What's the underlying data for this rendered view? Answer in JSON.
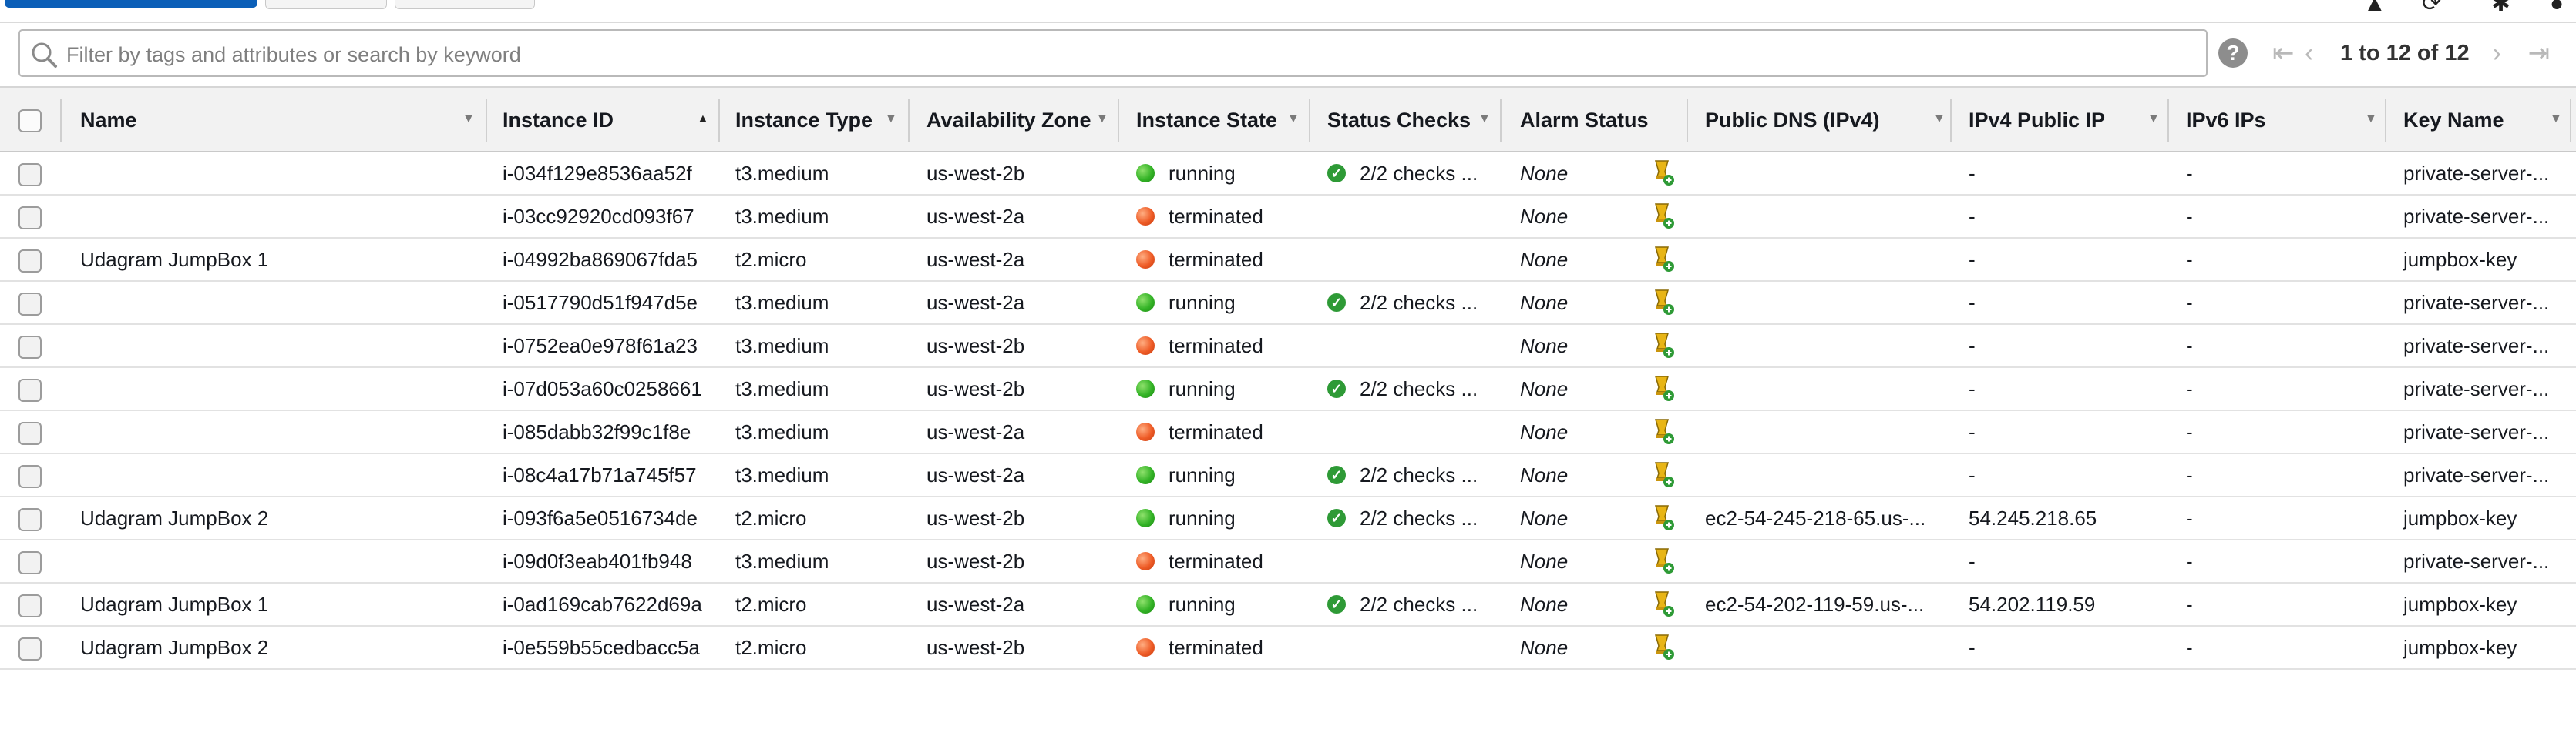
{
  "search": {
    "placeholder": "Filter by tags and attributes or search by keyword"
  },
  "help_label": "?",
  "pagination": {
    "text": "1 to 12 of 12"
  },
  "columns": [
    {
      "label": "Name"
    },
    {
      "label": "Instance ID"
    },
    {
      "label": "Instance Type"
    },
    {
      "label": "Availability Zone"
    },
    {
      "label": "Instance State"
    },
    {
      "label": "Status Checks"
    },
    {
      "label": "Alarm Status"
    },
    {
      "label": "Public DNS (IPv4)"
    },
    {
      "label": "IPv4 Public IP"
    },
    {
      "label": "IPv6 IPs"
    },
    {
      "label": "Key Name"
    }
  ],
  "state_colors": {
    "running": "#33b326",
    "terminated": "#ee5b26"
  },
  "accent_color": "#0b5fb8",
  "rows": [
    {
      "name": "",
      "id": "i-034f129e8536aa52f",
      "type": "t3.medium",
      "az": "us-west-2b",
      "state": "running",
      "checks": "2/2 checks ...",
      "alarm": "None",
      "dns": "",
      "ip": "-",
      "ipv6": "-",
      "key": "private-server-..."
    },
    {
      "name": "",
      "id": "i-03cc92920cd093f67",
      "type": "t3.medium",
      "az": "us-west-2a",
      "state": "terminated",
      "checks": "",
      "alarm": "None",
      "dns": "",
      "ip": "-",
      "ipv6": "-",
      "key": "private-server-..."
    },
    {
      "name": "Udagram JumpBox 1",
      "id": "i-04992ba869067fda5",
      "type": "t2.micro",
      "az": "us-west-2a",
      "state": "terminated",
      "checks": "",
      "alarm": "None",
      "dns": "",
      "ip": "-",
      "ipv6": "-",
      "key": "jumpbox-key"
    },
    {
      "name": "",
      "id": "i-0517790d51f947d5e",
      "type": "t3.medium",
      "az": "us-west-2a",
      "state": "running",
      "checks": "2/2 checks ...",
      "alarm": "None",
      "dns": "",
      "ip": "-",
      "ipv6": "-",
      "key": "private-server-..."
    },
    {
      "name": "",
      "id": "i-0752ea0e978f61a23",
      "type": "t3.medium",
      "az": "us-west-2b",
      "state": "terminated",
      "checks": "",
      "alarm": "None",
      "dns": "",
      "ip": "-",
      "ipv6": "-",
      "key": "private-server-..."
    },
    {
      "name": "",
      "id": "i-07d053a60c0258661",
      "type": "t3.medium",
      "az": "us-west-2b",
      "state": "running",
      "checks": "2/2 checks ...",
      "alarm": "None",
      "dns": "",
      "ip": "-",
      "ipv6": "-",
      "key": "private-server-..."
    },
    {
      "name": "",
      "id": "i-085dabb32f99c1f8e",
      "type": "t3.medium",
      "az": "us-west-2a",
      "state": "terminated",
      "checks": "",
      "alarm": "None",
      "dns": "",
      "ip": "-",
      "ipv6": "-",
      "key": "private-server-..."
    },
    {
      "name": "",
      "id": "i-08c4a17b71a745f57",
      "type": "t3.medium",
      "az": "us-west-2a",
      "state": "running",
      "checks": "2/2 checks ...",
      "alarm": "None",
      "dns": "",
      "ip": "-",
      "ipv6": "-",
      "key": "private-server-..."
    },
    {
      "name": "Udagram JumpBox 2",
      "id": "i-093f6a5e0516734de",
      "type": "t2.micro",
      "az": "us-west-2b",
      "state": "running",
      "checks": "2/2 checks ...",
      "alarm": "None",
      "dns": "ec2-54-245-218-65.us-...",
      "ip": "54.245.218.65",
      "ipv6": "-",
      "key": "jumpbox-key"
    },
    {
      "name": "",
      "id": "i-09d0f3eab401fb948",
      "type": "t3.medium",
      "az": "us-west-2b",
      "state": "terminated",
      "checks": "",
      "alarm": "None",
      "dns": "",
      "ip": "-",
      "ipv6": "-",
      "key": "private-server-..."
    },
    {
      "name": "Udagram JumpBox 1",
      "id": "i-0ad169cab7622d69a",
      "type": "t2.micro",
      "az": "us-west-2a",
      "state": "running",
      "checks": "2/2 checks ...",
      "alarm": "None",
      "dns": "ec2-54-202-119-59.us-...",
      "ip": "54.202.119.59",
      "ipv6": "-",
      "key": "jumpbox-key"
    },
    {
      "name": "Udagram JumpBox 2",
      "id": "i-0e559b55cedbacc5a",
      "type": "t2.micro",
      "az": "us-west-2b",
      "state": "terminated",
      "checks": "",
      "alarm": "None",
      "dns": "",
      "ip": "-",
      "ipv6": "-",
      "key": "jumpbox-key"
    }
  ]
}
